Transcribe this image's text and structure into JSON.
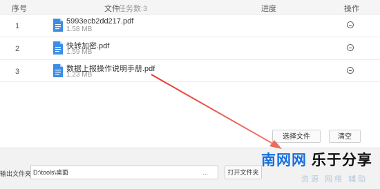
{
  "table": {
    "headers": {
      "number": "序号",
      "file": "文件",
      "task_count": "任务数:3",
      "progress": "进度",
      "operations": "操作"
    },
    "rows": [
      {
        "number": "1",
        "name": "5993ecb2dd217.pdf",
        "size": "1.58 MB"
      },
      {
        "number": "2",
        "name": "快转加密.pdf",
        "size": "1.59 MB"
      },
      {
        "number": "3",
        "name": "数据上报操作说明手册.pdf",
        "size": "1.23 MB"
      }
    ]
  },
  "buttons": {
    "select_files": "选择文件",
    "clear": "清空",
    "more": "...",
    "open_folder": "打开文件夹"
  },
  "output": {
    "label": "输出文件夹:",
    "path": "D:\\tools\\桌面"
  },
  "watermark": {
    "part_a": "南网网",
    "part_b": "乐于分享",
    "subtitle": "资源 网络 辅助"
  },
  "colors": {
    "file_icon": "#3b8de8",
    "arrow": "#e8352a",
    "brand_blue": "#1670dc"
  }
}
